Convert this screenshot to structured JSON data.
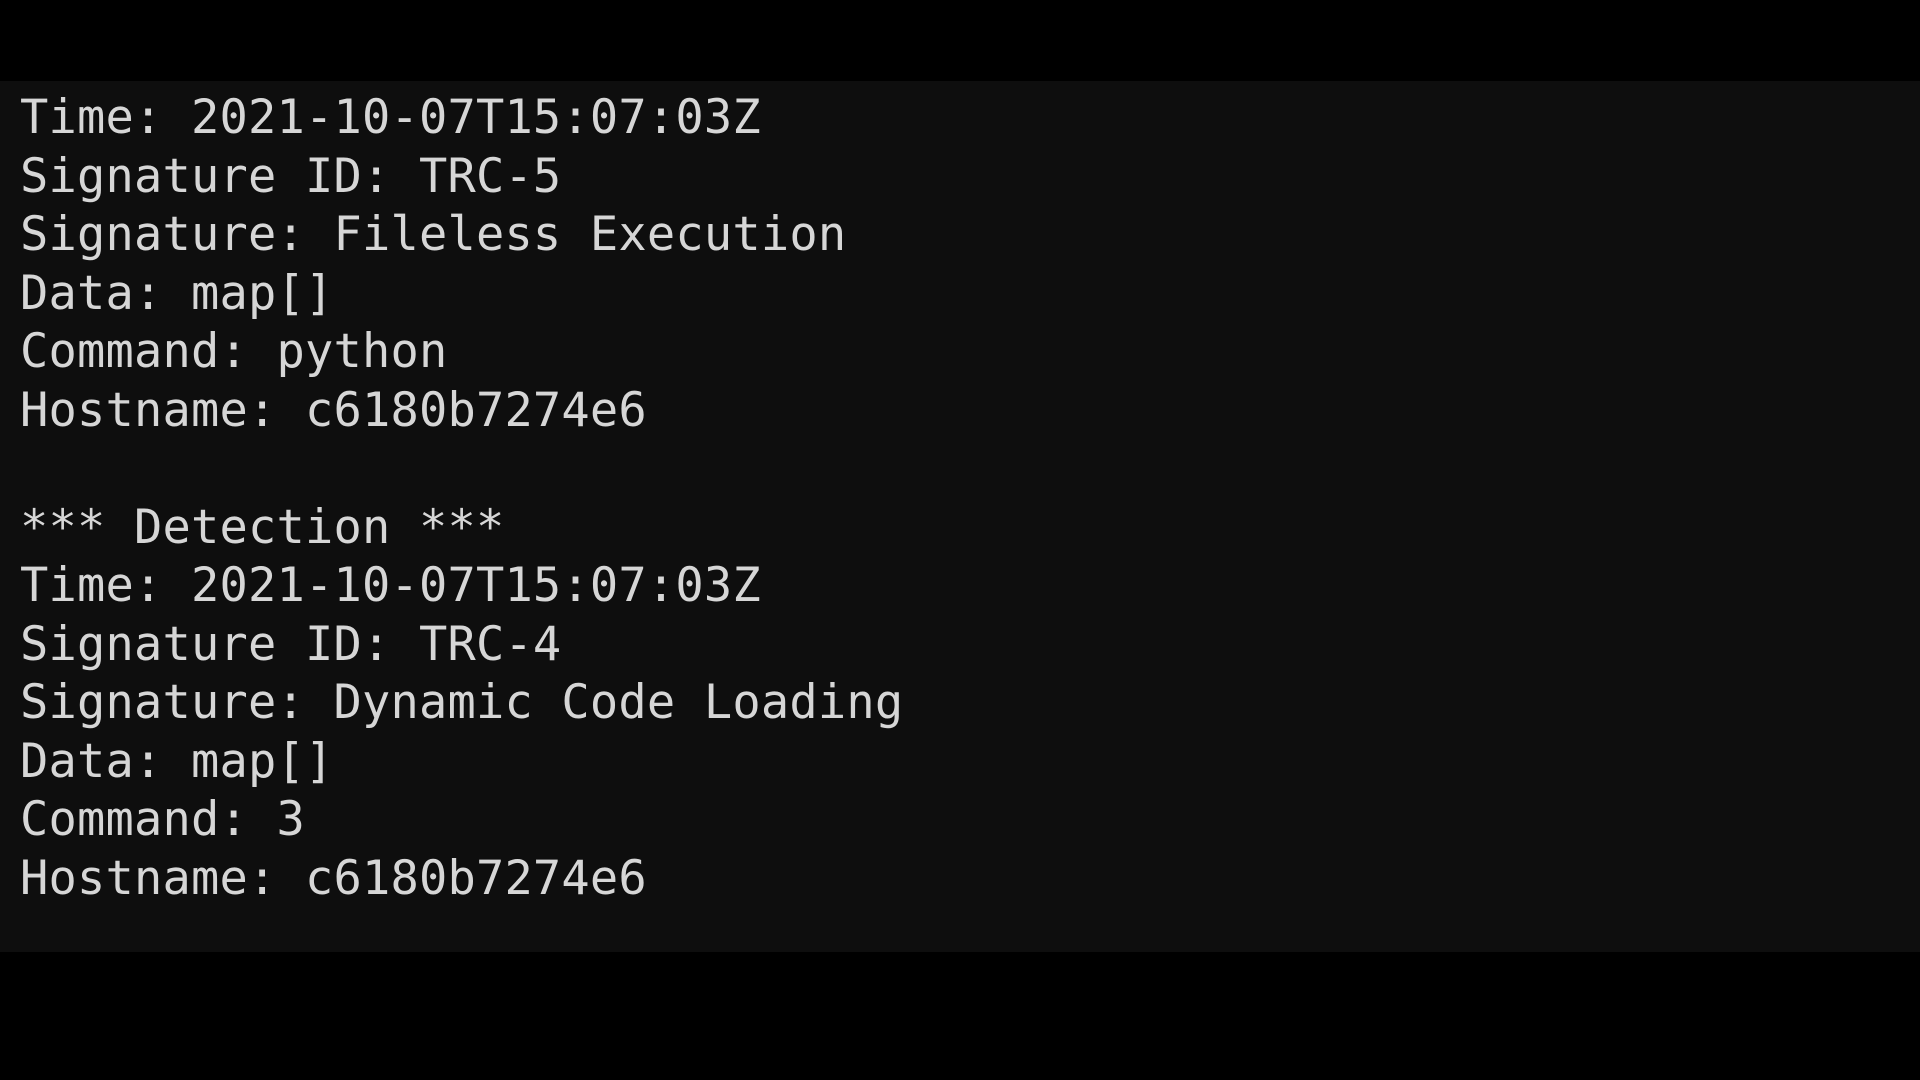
{
  "terminal": {
    "detection_1": {
      "time": "Time: 2021-10-07T15:07:03Z",
      "signature_id": "Signature ID: TRC-5",
      "signature": "Signature: Fileless Execution",
      "data": "Data: map[]",
      "command": "Command: python",
      "hostname": "Hostname: c6180b7274e6"
    },
    "detection_2": {
      "header": "*** Detection ***",
      "time": "Time: 2021-10-07T15:07:03Z",
      "signature_id": "Signature ID: TRC-4",
      "signature": "Signature: Dynamic Code Loading",
      "data": "Data: map[]",
      "command": "Command: 3",
      "hostname": "Hostname: c6180b7274e6"
    }
  },
  "colors": {
    "background": "#0e0e0e",
    "text": "#d6d6d6",
    "letterbox": "#000000"
  }
}
